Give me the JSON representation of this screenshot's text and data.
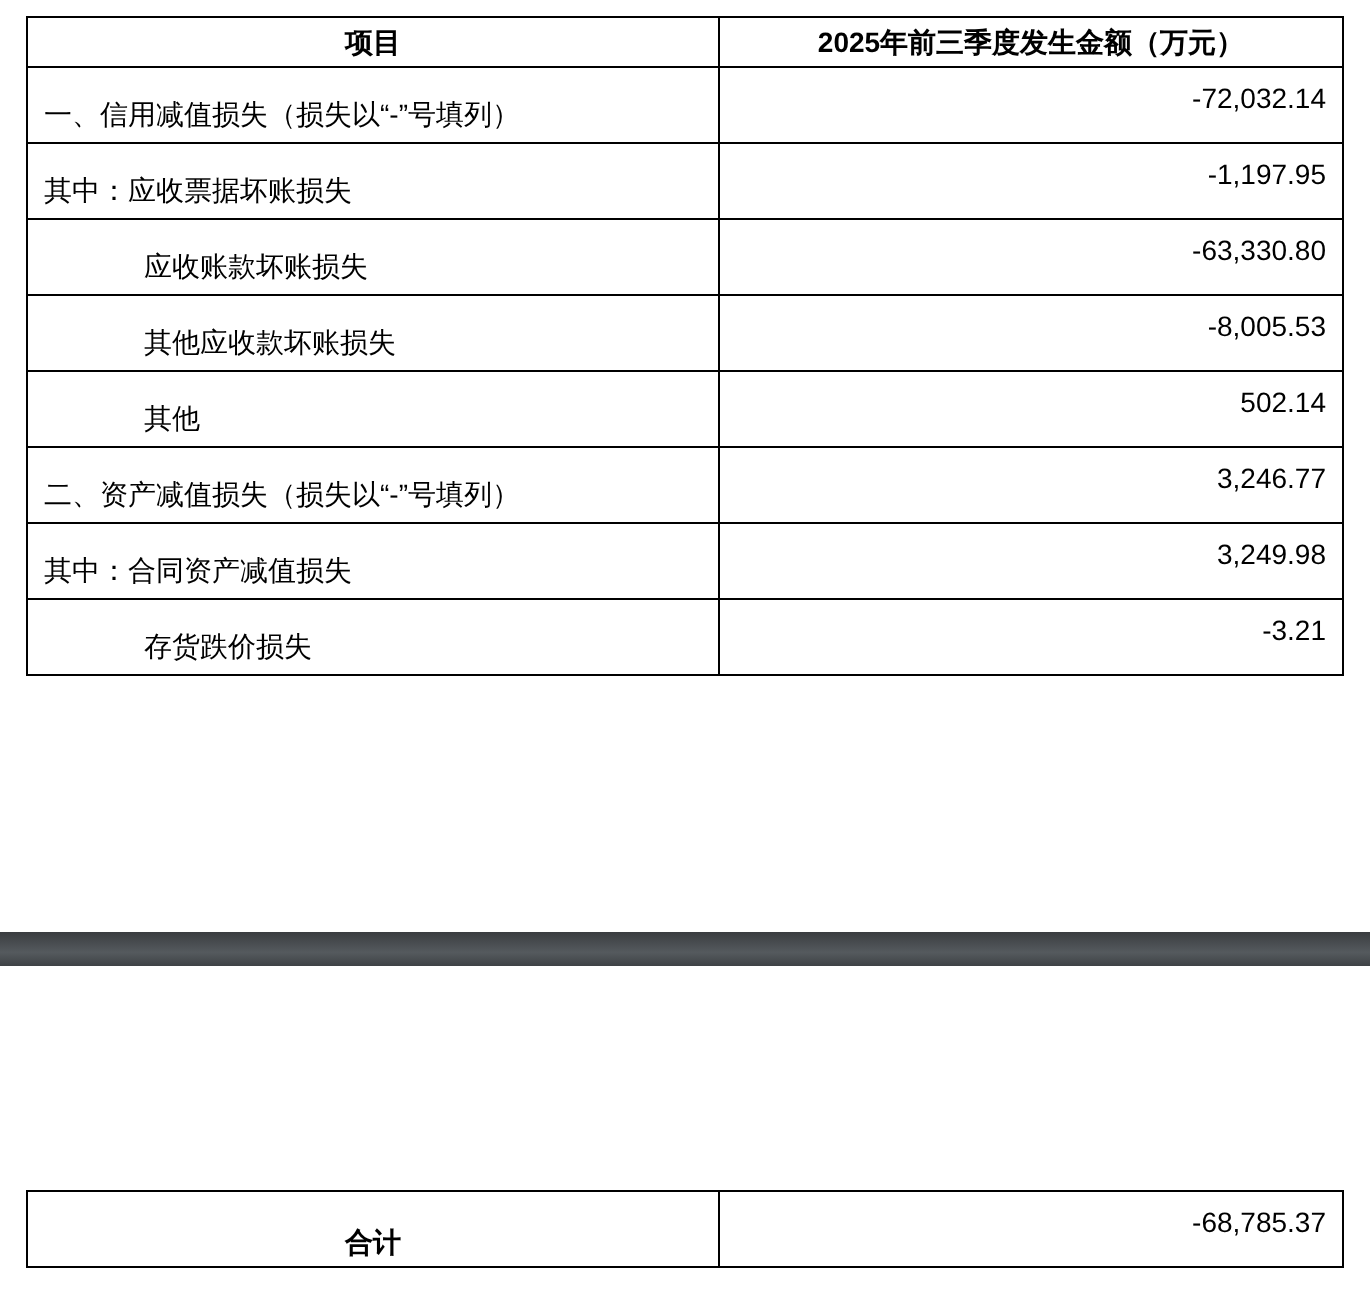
{
  "page_1": {
    "table": {
      "columns": [
        "项目",
        "2025年前三季度发生金额（万元）"
      ],
      "rows": [
        {
          "item": "一、信用减值损失（损失以“-”号填列）",
          "amount": "-72,032.14",
          "indented": false
        },
        {
          "item": "其中：应收票据坏账损失",
          "amount": "-1,197.95",
          "indented": false
        },
        {
          "item": "应收账款坏账损失",
          "amount": "-63,330.80",
          "indented": true
        },
        {
          "item": "其他应收款坏账损失",
          "amount": "-8,005.53",
          "indented": true
        },
        {
          "item": "其他",
          "amount": "502.14",
          "indented": true
        },
        {
          "item": "二、资产减值损失（损失以“-”号填列）",
          "amount": "3,246.77",
          "indented": false
        },
        {
          "item": "其中：合同资产减值损失",
          "amount": "3,249.98",
          "indented": false
        },
        {
          "item": "存货跌价损失",
          "amount": "-3.21",
          "indented": true
        }
      ]
    }
  },
  "page_2": {
    "total_row": {
      "item": "合计",
      "amount": "-68,785.37"
    }
  }
}
